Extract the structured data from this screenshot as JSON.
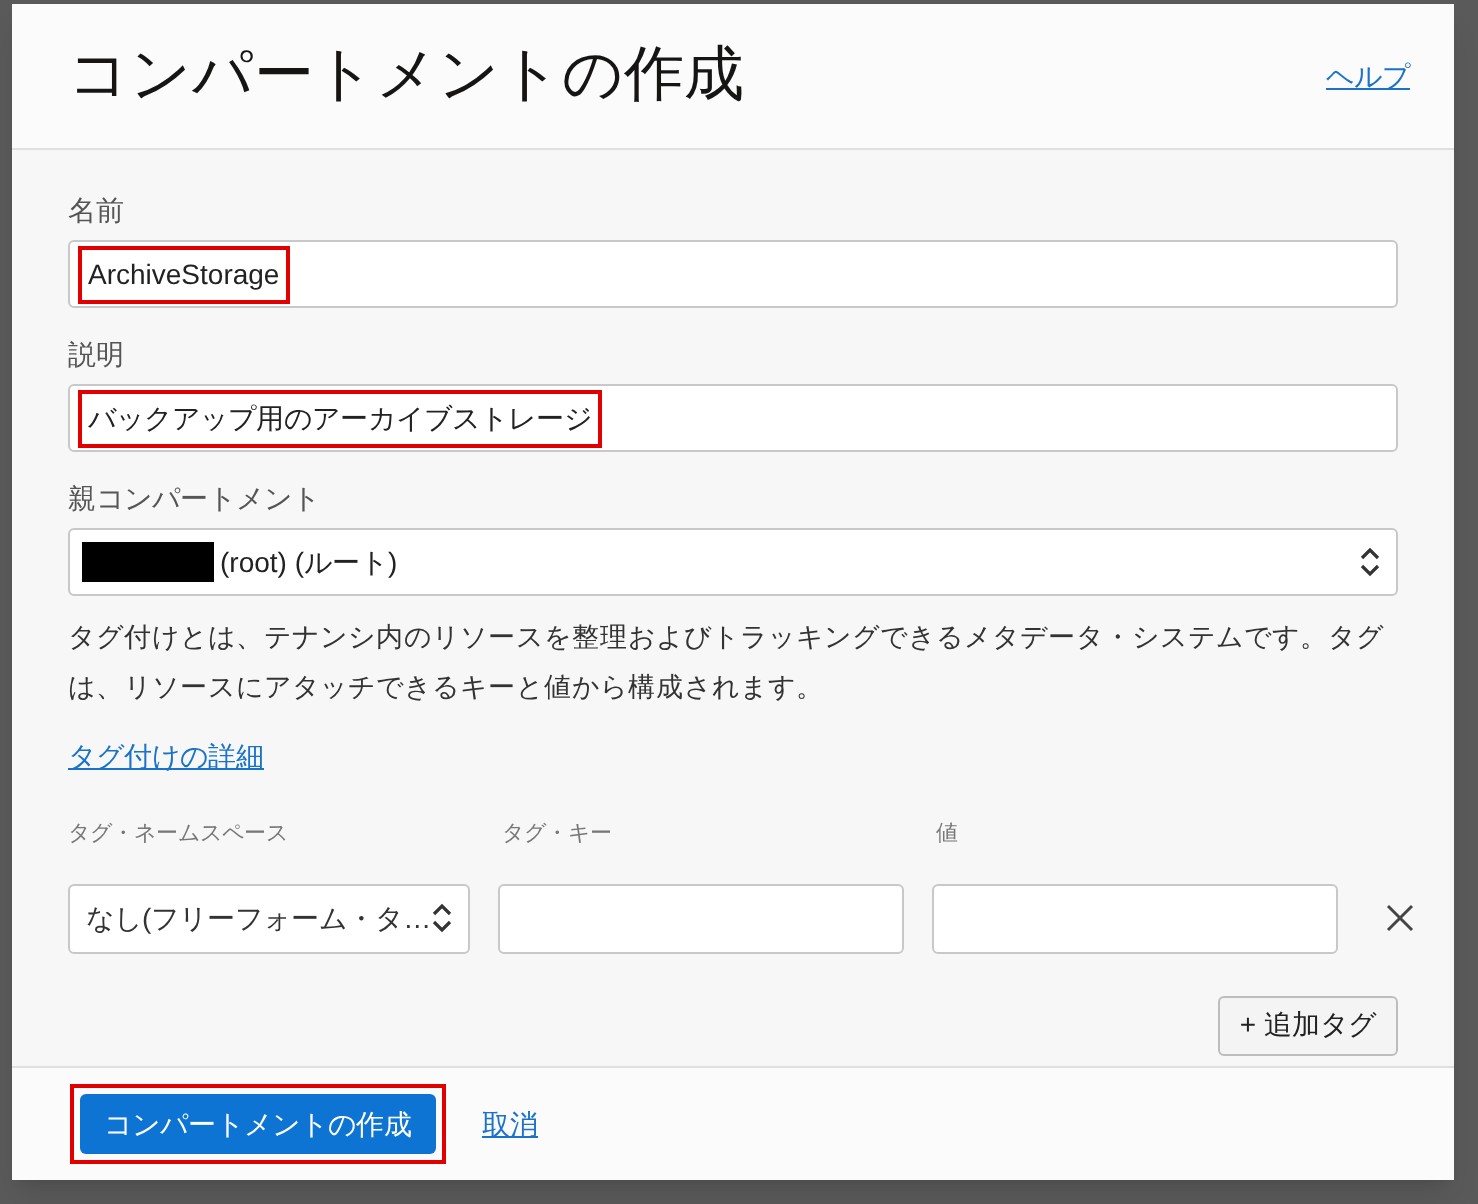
{
  "dialog": {
    "title": "コンパートメントの作成",
    "help_link": "ヘルプ"
  },
  "fields": [
    {
      "kind": "text",
      "label": "名前",
      "value": "ArchiveStorage",
      "highlighted": true
    },
    {
      "kind": "text",
      "label": "説明",
      "value": "バックアップ用のアーカイブストレージ",
      "highlighted": true
    },
    {
      "kind": "select",
      "label": "親コンパートメント",
      "value": "(root) (ルート)",
      "redacted": true,
      "highlighted": false
    }
  ],
  "tagging": {
    "description": "タグ付けとは、テナンシ内のリソースを整理およびトラッキングできるメタデータ・システムです。タグは、リソースにアタッチできるキーと値から構成されます。",
    "details_link": "タグ付けの詳細",
    "columns": [
      "タグ・ネームスペース",
      "タグ・キー",
      "値"
    ],
    "row": {
      "namespace": "なし(フリーフォーム・タ…"
    },
    "add_button": "+ 追加タグ"
  },
  "footer": {
    "create_button": {
      "label": "コンパートメントの作成",
      "highlighted": true
    },
    "cancel_link": "取消"
  }
}
